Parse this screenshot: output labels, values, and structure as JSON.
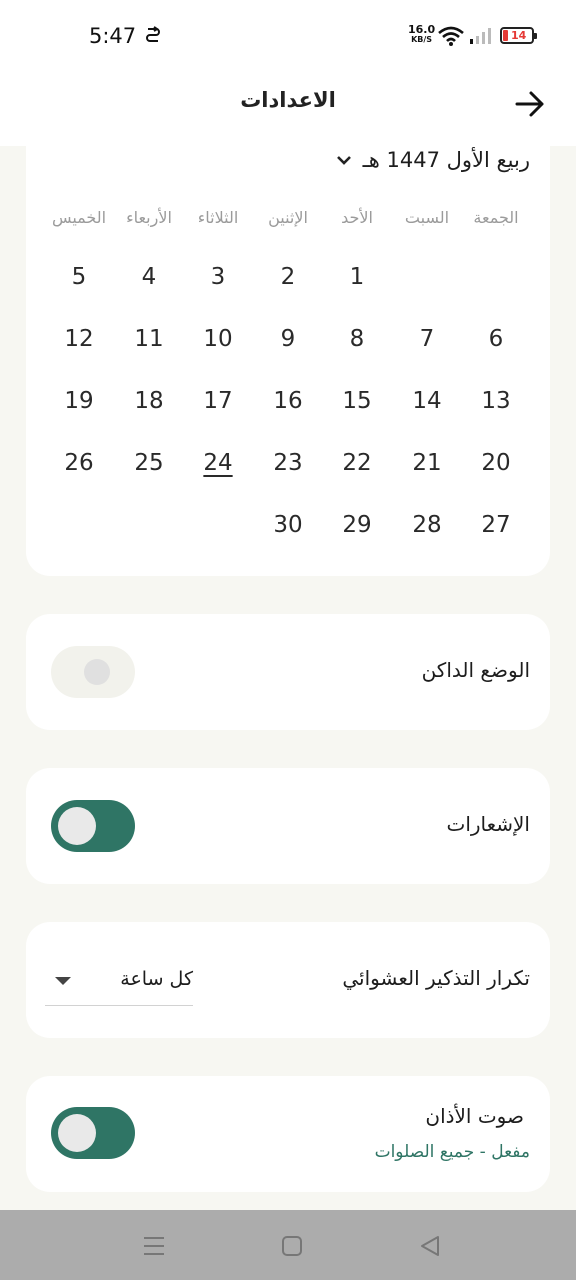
{
  "status_bar": {
    "time": "5:47",
    "sync_icon": "sync-icon",
    "net_speed": "16.0",
    "net_speed_unit": "KB/S",
    "battery": "14",
    "battery_color": "#e53935"
  },
  "header": {
    "title": "الاعدادات",
    "back_icon": "arrow-right-icon"
  },
  "calendar": {
    "month": "ربيع الأول 1447 هـ",
    "weekdays": [
      "الجمعة",
      "السبت",
      "الأحد",
      "الإثنين",
      "الثلاثاء",
      "الأربعاء",
      "الخميس"
    ],
    "weeks": [
      [
        "",
        "",
        "1",
        "2",
        "3",
        "4",
        "5"
      ],
      [
        "6",
        "7",
        "8",
        "9",
        "10",
        "11",
        "12"
      ],
      [
        "13",
        "14",
        "15",
        "16",
        "17",
        "18",
        "19"
      ],
      [
        "20",
        "21",
        "22",
        "23",
        "24",
        "25",
        "26"
      ],
      [
        "27",
        "28",
        "29",
        "30",
        "",
        "",
        ""
      ]
    ],
    "today": "24"
  },
  "settings": {
    "dark_mode": {
      "label": "الوضع الداكن",
      "enabled": false
    },
    "notifications": {
      "label": "الإشعارات",
      "enabled": true
    },
    "random_reminder": {
      "label": "تكرار التذكير العشوائي",
      "value": "كل ساعة"
    },
    "adhan_sound": {
      "label": "صوت الأذان",
      "sub_label": "مفعل - جميع الصلوات",
      "enabled": true
    }
  },
  "colors": {
    "accent": "#2f7565",
    "background": "#f7f7f2",
    "card": "#ffffff"
  },
  "nav_bar": {
    "icons": [
      "menu-icon",
      "home-square-icon",
      "back-triangle-icon"
    ]
  }
}
